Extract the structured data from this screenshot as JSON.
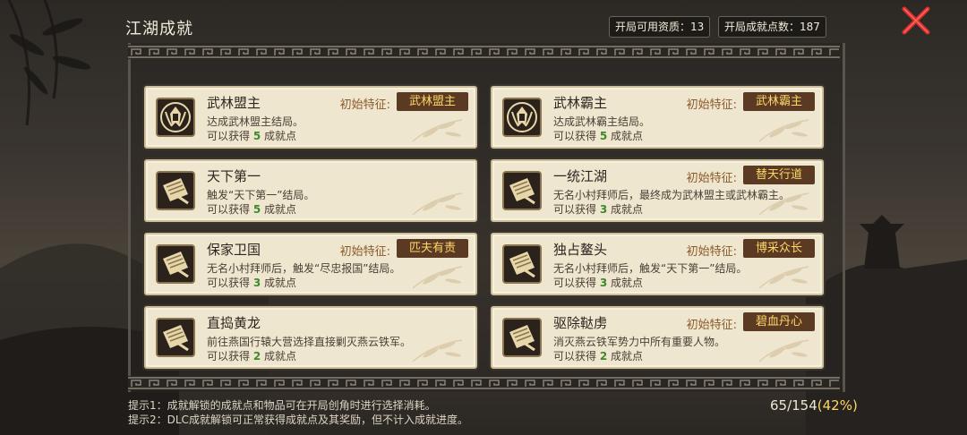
{
  "header": {
    "title": "江湖成就",
    "available_label": "开局可用资质：13",
    "points_label": "开局成就点数：187"
  },
  "cards": [
    {
      "name": "武林盟主",
      "desc": "达成武林盟主结局。",
      "pts_prefix": "可以获得",
      "pts": "5",
      "pts_suffix": "成就点",
      "trait_label": "初始特征:",
      "trait": "武林盟主",
      "icon": "crest-icon"
    },
    {
      "name": "武林霸主",
      "desc": "达成武林霸主结局。",
      "pts_prefix": "可以获得",
      "pts": "5",
      "pts_suffix": "成就点",
      "trait_label": "初始特征:",
      "trait": "武林霸主",
      "icon": "crest-icon"
    },
    {
      "name": "天下第一",
      "desc": "触发“天下第一”结局。",
      "pts_prefix": "可以获得",
      "pts": "5",
      "pts_suffix": "成就点",
      "trait_label": "",
      "trait": "",
      "icon": "scroll-icon"
    },
    {
      "name": "一统江湖",
      "desc": "无名小村拜师后，最终成为武林盟主或武林霸主。",
      "pts_prefix": "可以获得",
      "pts": "3",
      "pts_suffix": "成就点",
      "trait_label": "初始特征:",
      "trait": "替天行道",
      "icon": "scroll-icon"
    },
    {
      "name": "保家卫国",
      "desc": "无名小村拜师后，触发“尽忠报国”结局。",
      "pts_prefix": "可以获得",
      "pts": "3",
      "pts_suffix": "成就点",
      "trait_label": "初始特征:",
      "trait": "匹夫有责",
      "icon": "scroll-icon"
    },
    {
      "name": "独占鳌头",
      "desc": "无名小村拜师后，触发“天下第一”结局。",
      "pts_prefix": "可以获得",
      "pts": "3",
      "pts_suffix": "成就点",
      "trait_label": "初始特征:",
      "trait": "博采众长",
      "icon": "scroll-icon"
    },
    {
      "name": "直捣黄龙",
      "desc": "前往燕国行辕大营选择直接剿灭燕云铁军。",
      "pts_prefix": "可以获得",
      "pts": "2",
      "pts_suffix": "成就点",
      "trait_label": "",
      "trait": "",
      "icon": "scroll-icon"
    },
    {
      "name": "驱除鞑虏",
      "desc": "消灭燕云铁军势力中所有重要人物。",
      "pts_prefix": "可以获得",
      "pts": "2",
      "pts_suffix": "成就点",
      "trait_label": "初始特征:",
      "trait": "碧血丹心",
      "icon": "scroll-icon"
    }
  ],
  "tips": [
    "提示1：成就解锁的成就点和物品可在开局创角时进行选择消耗。",
    "提示2：DLC成就解锁可正常获得成就点及其奖励，但不计入成就进度。"
  ],
  "progress": {
    "count": "65/154",
    "percent": "(42%)"
  },
  "colors": {
    "accent": "#ffd66a",
    "card_bg": "#efe6cf",
    "trait_bg": "#5a3a22",
    "close_red": "#d83030"
  }
}
